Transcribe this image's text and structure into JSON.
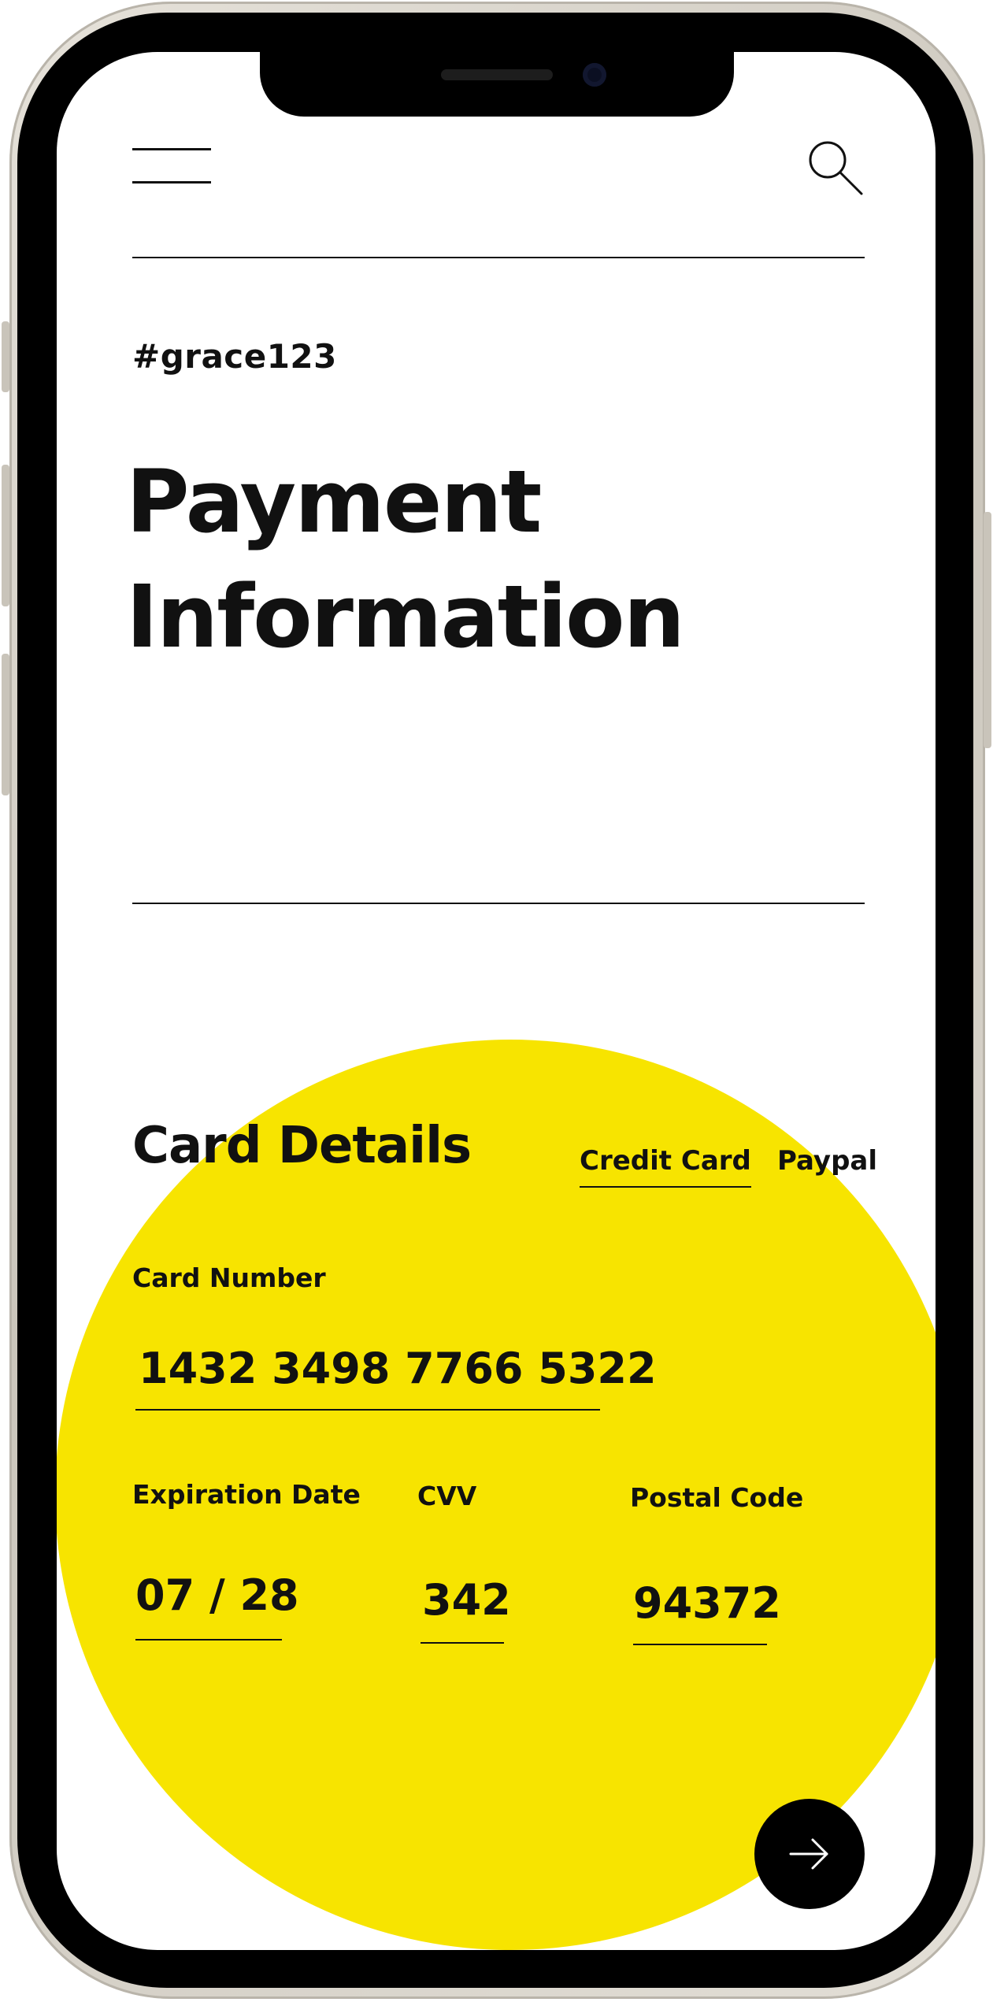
{
  "header": {
    "menu_icon": "hamburger-menu-icon",
    "search_icon": "search-icon"
  },
  "user": {
    "handle": "#grace123"
  },
  "page": {
    "title_line1": "Payment",
    "title_line2": "Information"
  },
  "card_details": {
    "title": "Card Details",
    "tabs": [
      {
        "label": "Credit Card",
        "active": true
      },
      {
        "label": "Paypal",
        "active": false
      }
    ],
    "card_number_label": "Card Number",
    "card_number_value": "1432 3498 7766 5322",
    "expiration_label": "Expiration Date",
    "expiration_value": "07 / 28",
    "cvv_label": "CVV",
    "cvv_value": "342",
    "postal_label": "Postal Code",
    "postal_value": "94372"
  },
  "actions": {
    "next_icon": "arrow-right-icon"
  },
  "colors": {
    "accent": "#f7e400",
    "text": "#111111",
    "button": "#000000"
  }
}
